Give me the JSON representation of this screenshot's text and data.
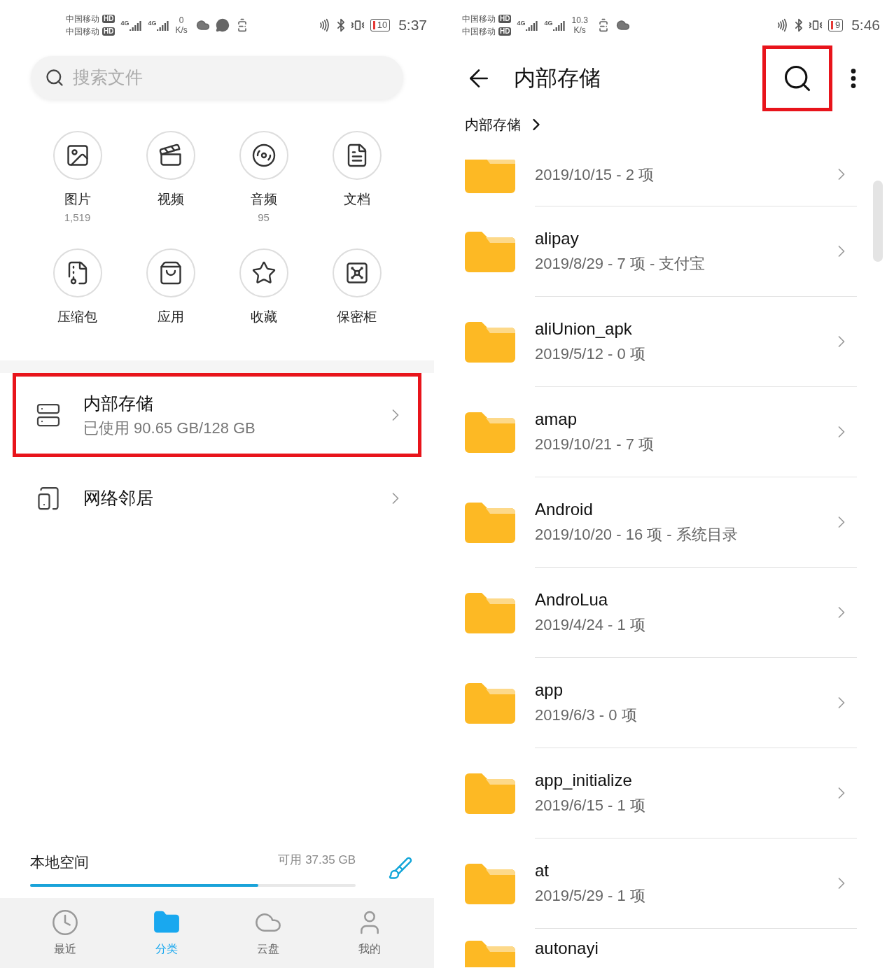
{
  "left_screen": {
    "status_bar": {
      "carriers": [
        {
          "name": "中国移动",
          "badge": "HD"
        },
        {
          "name": "中国移动",
          "badge": "HD"
        }
      ],
      "networks": [
        "4G",
        "4G"
      ],
      "speed_value": "0",
      "speed_unit": "K/s",
      "notifications": [
        {
          "kind": "cloud"
        },
        {
          "kind": "chat"
        },
        {
          "kind": "alert"
        }
      ],
      "battery": "10",
      "time": "5:37"
    },
    "search": {
      "placeholder": "搜索文件"
    },
    "categories": [
      {
        "label": "图片",
        "count": "1,519"
      },
      {
        "label": "视频"
      },
      {
        "label": "音频",
        "count": "95"
      },
      {
        "label": "文档"
      },
      {
        "label": "压缩包"
      },
      {
        "label": "应用"
      },
      {
        "label": "收藏"
      },
      {
        "label": "保密柜"
      }
    ],
    "storage_items": [
      {
        "title": "内部存储",
        "detail": "已使用 90.65 GB/128 GB",
        "highlighted": true
      },
      {
        "title": "网络邻居",
        "highlighted": false
      }
    ],
    "local_space": {
      "label": "本地空间",
      "available": "可用 37.35 GB",
      "level": 0.7
    },
    "bottom_nav": [
      {
        "label": "最近",
        "selected": false
      },
      {
        "label": "分类",
        "selected": true
      },
      {
        "label": "云盘",
        "selected": false
      },
      {
        "label": "我的",
        "selected": false
      }
    ]
  },
  "right_screen": {
    "status_bar": {
      "carriers": [
        {
          "name": "中国移动",
          "badge": "HD"
        },
        {
          "name": "中国移动",
          "badge": "HD"
        }
      ],
      "networks": [
        "4G",
        "4G"
      ],
      "speed_value": "10.3",
      "speed_unit": "K/s",
      "notifications": [
        {
          "kind": "alert"
        },
        {
          "kind": "cloud"
        }
      ],
      "battery": "9",
      "time": "5:46"
    },
    "title": "内部存储",
    "search_highlighted": true,
    "breadcrumb": [
      "内部存储"
    ],
    "folders": [
      {
        "details": "2019/10/15 - 2 项"
      },
      {
        "name": "alipay",
        "details": "2019/8/29 - 7 项 - 支付宝"
      },
      {
        "name": "aliUnion_apk",
        "details": "2019/5/12 - 0 项"
      },
      {
        "name": "amap",
        "details": "2019/10/21 - 7 项"
      },
      {
        "name": "Android",
        "details": "2019/10/20 - 16 项 - 系统目录"
      },
      {
        "name": "AndroLua",
        "details": "2019/4/24 - 1 项"
      },
      {
        "name": "app",
        "details": "2019/6/3 - 0 项"
      },
      {
        "name": "app_initialize",
        "details": "2019/6/15 - 1 项"
      },
      {
        "name": "at",
        "details": "2019/5/29 - 1 项"
      },
      {
        "name": "autonayi"
      }
    ]
  }
}
